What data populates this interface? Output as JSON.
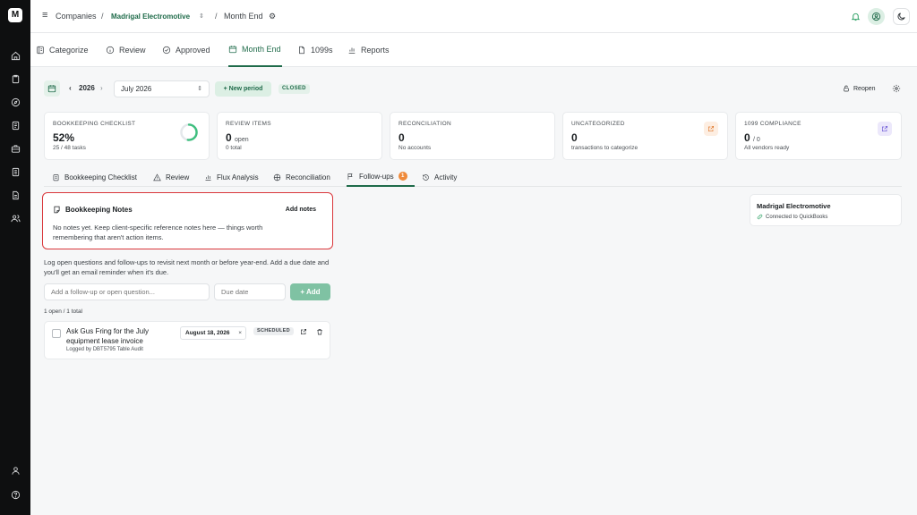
{
  "brand": {
    "logo_text": "M"
  },
  "breadcrumb": {
    "companies": "Companies",
    "sep1": "/",
    "company": "Madrigal Electromotive",
    "sep2": "/",
    "page": "Month End"
  },
  "nav_tabs": [
    {
      "label": "Categorize",
      "icon": "categorize-icon"
    },
    {
      "label": "Review",
      "icon": "info-icon"
    },
    {
      "label": "Approved",
      "icon": "check-circle-icon"
    },
    {
      "label": "Month End",
      "icon": "calendar-icon",
      "active": true
    },
    {
      "label": "1099s",
      "icon": "document-icon"
    },
    {
      "label": "Reports",
      "icon": "bar-chart-icon"
    }
  ],
  "period": {
    "year": "2026",
    "month": "July 2026",
    "new_period": "+ New period",
    "status": "CLOSED",
    "reopen": "Reopen"
  },
  "cards": {
    "checklist": {
      "label": "Bookkeeping Checklist",
      "value": "52%",
      "progress": 0.52,
      "sub": "25 / 48 tasks"
    },
    "review": {
      "label": "Review Items",
      "value": "0",
      "unit": "open",
      "sub": "0 total"
    },
    "reconciliation": {
      "label": "Reconciliation",
      "value": "0",
      "sub": "No accounts"
    },
    "uncategorized": {
      "label": "Uncategorized",
      "value": "0",
      "sub": "transactions to categorize"
    },
    "compliance": {
      "label": "1099 Compliance",
      "value": "0",
      "unit": "/ 0",
      "sub": "All vendors ready"
    }
  },
  "sub_tabs": [
    {
      "label": "Bookkeeping Checklist"
    },
    {
      "label": "Review"
    },
    {
      "label": "Flux Analysis"
    },
    {
      "label": "Reconciliation"
    },
    {
      "label": "Follow-ups",
      "badge": "1",
      "active": true
    },
    {
      "label": "Activity"
    }
  ],
  "notes": {
    "title": "Bookkeeping Notes",
    "add": "Add notes",
    "empty": "No notes yet. Keep client-specific reference notes here — things worth remembering that aren't action items."
  },
  "followups": {
    "intro": "Log open questions and follow-ups to revisit next month or before year-end. Add a due date and you'll get an email reminder when it's due.",
    "input_placeholder": "Add a follow-up or open question...",
    "due_placeholder": "Due date",
    "add_label": "+ Add",
    "count": "1 open / 1 total",
    "items": [
      {
        "text": "Ask Gus Fring for the July equipment lease invoice",
        "logged": "Logged by DBT5795 Table Audit",
        "due": "August 18, 2026",
        "clear": "×",
        "status": "SCHEDULED"
      }
    ]
  },
  "company_panel": {
    "name": "Madrigal Electromotive",
    "connection": "Connected to QuickBooks"
  },
  "colors": {
    "accent": "#1f6b4a",
    "highlight": "#d9363a",
    "badge": "#ef8a3a"
  }
}
